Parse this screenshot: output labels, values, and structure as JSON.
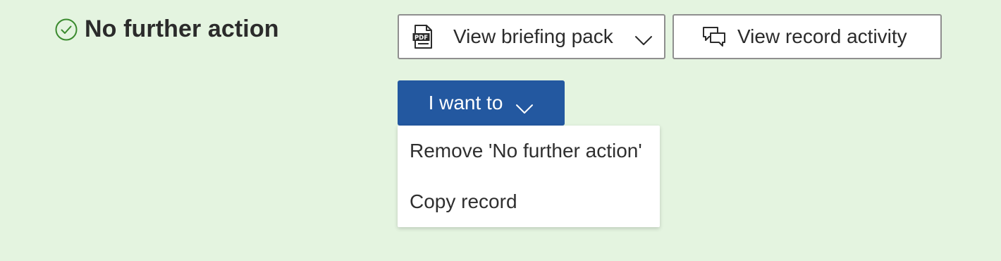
{
  "status": {
    "text": "No further action",
    "icon": "check-circle-icon",
    "icon_color": "#3a8a2e"
  },
  "actions": {
    "briefing_pack_label": "View briefing pack",
    "briefing_pack_icon": "pdf-icon",
    "record_activity_label": "View record activity",
    "record_activity_icon": "chat-bubbles-icon"
  },
  "primary_menu": {
    "label": "I want to",
    "expanded": true,
    "items": [
      {
        "label": "Remove 'No further action'"
      },
      {
        "label": "Copy record"
      }
    ]
  },
  "colors": {
    "background": "#e4f4e0",
    "primary": "#2358a0",
    "border": "#8f8f8f"
  }
}
